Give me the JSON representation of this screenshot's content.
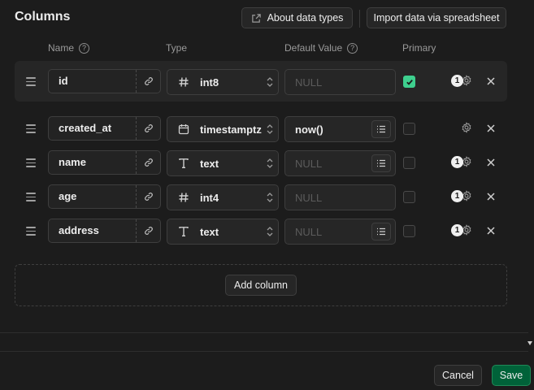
{
  "header": {
    "title": "Columns",
    "about_label": "About data types",
    "import_label": "Import data via spreadsheet"
  },
  "table_headers": {
    "name": "Name",
    "type": "Type",
    "default_value": "Default Value",
    "primary": "Primary",
    "help_glyph": "?"
  },
  "rows": [
    {
      "name": "id",
      "type": "int8",
      "type_icon": "hash-icon",
      "default": "NULL",
      "default_is_placeholder": true,
      "primary": true,
      "badge": "1"
    },
    {
      "name": "created_at",
      "type": "timestamptz",
      "type_icon": "calendar-icon",
      "default": "now()",
      "default_is_placeholder": false,
      "primary": false,
      "badge": ""
    },
    {
      "name": "name",
      "type": "text",
      "type_icon": "text-icon",
      "default": "NULL",
      "default_is_placeholder": true,
      "primary": false,
      "badge": "1"
    },
    {
      "name": "age",
      "type": "int4",
      "type_icon": "hash-icon",
      "default": "NULL",
      "default_is_placeholder": true,
      "primary": false,
      "badge": "1"
    },
    {
      "name": "address",
      "type": "text",
      "type_icon": "text-icon",
      "default": "NULL",
      "default_is_placeholder": true,
      "primary": false,
      "badge": "1"
    }
  ],
  "add_column_label": "Add column",
  "footer": {
    "cancel_label": "Cancel",
    "save_label": "Save"
  },
  "colors": {
    "background": "#1c1c1c",
    "accent_green": "#3ecf8e",
    "save_bg": "#006239"
  }
}
